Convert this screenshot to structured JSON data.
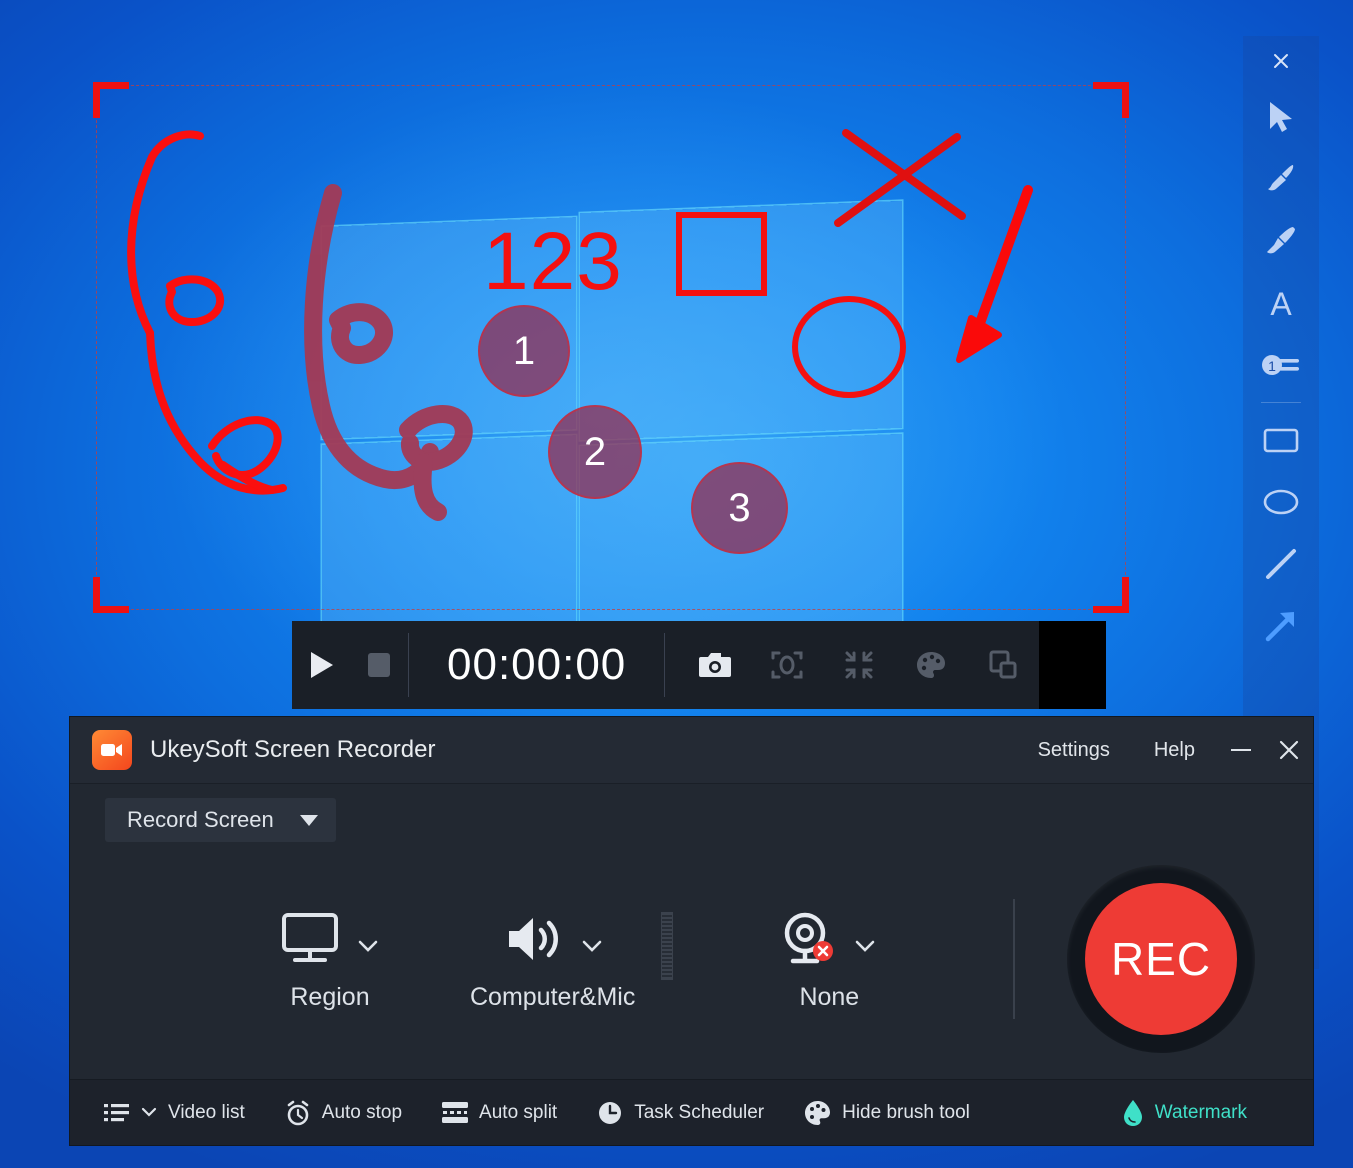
{
  "app": {
    "title": "UkeySoft Screen Recorder",
    "icon": "video-camera-icon",
    "titlebar_links": [
      {
        "label": "Settings",
        "name": "settings-link"
      },
      {
        "label": "Help",
        "name": "help-link"
      }
    ],
    "window_controls": [
      {
        "label": "minimize",
        "name": "minimize-icon"
      },
      {
        "label": "close",
        "name": "close-icon"
      }
    ]
  },
  "mode": {
    "selected": "Record Screen",
    "caret": "chevron-down-icon"
  },
  "options": [
    {
      "key": "region",
      "label": "Region",
      "icon": "monitor-icon",
      "caret": "chevron-down-icon"
    },
    {
      "key": "audio",
      "label": "Computer&Mic",
      "icon": "speaker-icon",
      "caret": "chevron-down-icon"
    },
    {
      "key": "webcam",
      "label": "None",
      "icon": "webcam-disabled-icon",
      "caret": "chevron-down-icon"
    }
  ],
  "record": {
    "label": "REC",
    "color": "#ee3b35"
  },
  "bottom_bar": {
    "items": [
      {
        "label": "Video list",
        "icon": "list-icon",
        "caret": "chevron-down-icon"
      },
      {
        "label": "Auto stop",
        "icon": "alarm-clock-icon"
      },
      {
        "label": "Auto split",
        "icon": "split-icon"
      },
      {
        "label": "Task Scheduler",
        "icon": "clock-icon"
      },
      {
        "label": "Hide brush tool",
        "icon": "palette-icon"
      }
    ],
    "watermark": {
      "label": "Watermark",
      "icon": "droplet-icon",
      "color": "#3fe0c8"
    }
  },
  "control_bar": {
    "timer": "00:00:00",
    "left_buttons": [
      {
        "name": "play-button",
        "icon": "play-icon"
      },
      {
        "name": "stop-button",
        "icon": "stop-icon"
      }
    ],
    "tool_buttons": [
      {
        "name": "snapshot-button",
        "icon": "camera-icon"
      },
      {
        "name": "spotlight-button",
        "icon": "spotlight-icon"
      },
      {
        "name": "collapse-button",
        "icon": "collapse-icon"
      },
      {
        "name": "brush-palette-button",
        "icon": "palette-icon"
      },
      {
        "name": "picture-in-picture-button",
        "icon": "duplicate-window-icon"
      }
    ]
  },
  "brush_toolbar": {
    "close": "close-icon",
    "tools": [
      {
        "name": "cursor-tool",
        "icon": "cursor-arrow-icon",
        "selected": false
      },
      {
        "name": "brush-tool",
        "icon": "paint-brush-icon",
        "selected": false
      },
      {
        "name": "marker-tool",
        "icon": "marker-pen-icon",
        "selected": false
      },
      {
        "name": "text-tool",
        "icon": "text-a-icon",
        "selected": false
      },
      {
        "name": "step-number-tool",
        "icon": "step-number-icon",
        "selected": false
      },
      {
        "name": "rectangle-tool",
        "icon": "rectangle-icon",
        "selected": false
      },
      {
        "name": "ellipse-tool",
        "icon": "ellipse-icon",
        "selected": false
      },
      {
        "name": "line-tool",
        "icon": "line-icon",
        "selected": false
      },
      {
        "name": "arrow-tool",
        "icon": "arrow-icon",
        "selected": true
      }
    ],
    "actions": [
      {
        "name": "undo-button",
        "icon": "undo-icon"
      },
      {
        "name": "delete-all-button",
        "icon": "trash-icon"
      },
      {
        "name": "stroke-width-button",
        "icon": "line-weight-icon"
      },
      {
        "name": "color-swatch-button",
        "icon": "color-circle-icon",
        "color": "#8a2b3c"
      },
      {
        "name": "more-button",
        "icon": "chevron-down-icon"
      }
    ]
  },
  "capture_region": {
    "selection_border_color": "#c83c3c",
    "handle_color": "#ee1111"
  },
  "annotations": {
    "text_label": "123",
    "text_color": "#f41010",
    "badges": [
      {
        "number": "1"
      },
      {
        "number": "2"
      },
      {
        "number": "3"
      }
    ],
    "badge_fill": "rgba(150,40,75,0.72)",
    "shapes": [
      {
        "name": "freehand-vine-drawing",
        "color": "#fa0f0f"
      },
      {
        "name": "brush-stroke-drawing",
        "color": "#a33a55"
      },
      {
        "name": "rectangle-shape",
        "color": "#f41010"
      },
      {
        "name": "ellipse-shape",
        "color": "#f41010"
      },
      {
        "name": "cross-mark-shape",
        "color": "#e01010"
      },
      {
        "name": "arrow-shape",
        "color": "#fa0a0a"
      }
    ]
  }
}
